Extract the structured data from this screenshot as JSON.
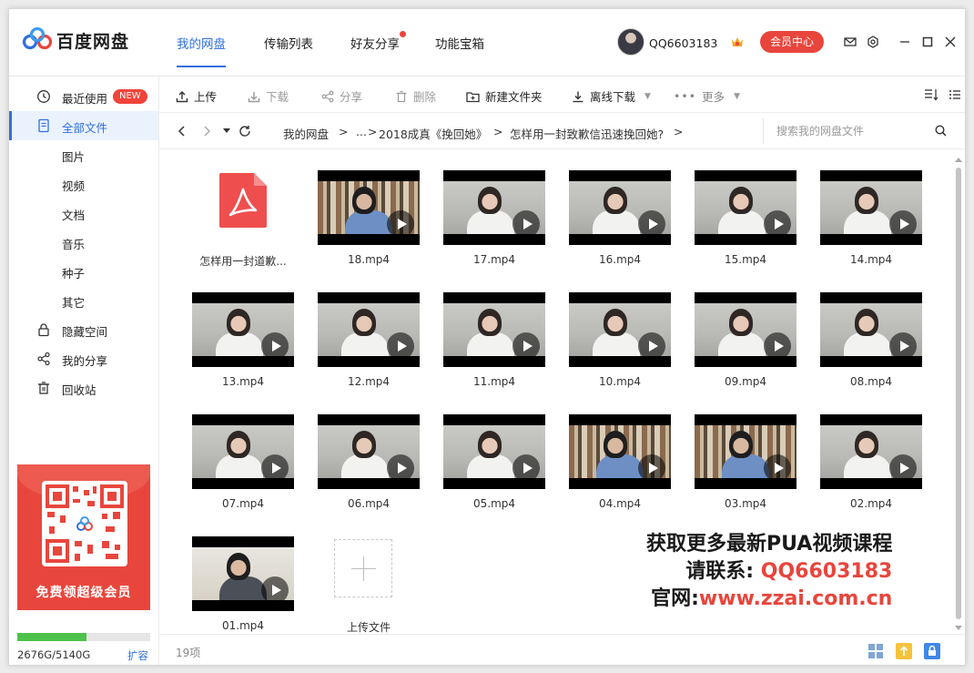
{
  "app": {
    "name": "百度网盘"
  },
  "nav_tabs": [
    {
      "label": "我的网盘",
      "active": true
    },
    {
      "label": "传输列表"
    },
    {
      "label": "好友分享",
      "dot": true
    },
    {
      "label": "功能宝箱"
    }
  ],
  "user": {
    "name": "QQ6603183",
    "vip_label": "会员中心"
  },
  "colors": {
    "accent": "#2f6fde",
    "red": "#e8453c",
    "quota": "#4dc24a"
  },
  "sidebar": {
    "items": [
      {
        "label": "最近使用",
        "icon": "clock-icon",
        "badge": "NEW"
      },
      {
        "label": "全部文件",
        "icon": "file-icon",
        "active": true
      },
      {
        "label": "图片"
      },
      {
        "label": "视频"
      },
      {
        "label": "文档"
      },
      {
        "label": "音乐"
      },
      {
        "label": "种子"
      },
      {
        "label": "其它"
      },
      {
        "label": "隐藏空间",
        "icon": "lock-icon"
      },
      {
        "label": "我的分享",
        "icon": "share-icon"
      },
      {
        "label": "回收站",
        "icon": "trash-icon"
      }
    ],
    "promo_text": "免费领超级会员",
    "quota_text": "2676G/5140G",
    "quota_fraction": 0.52,
    "expand_label": "扩容"
  },
  "toolbar": {
    "upload": "上传",
    "download": "下载",
    "share": "分享",
    "delete": "删除",
    "new_folder": "新建文件夹",
    "offline": "离线下载",
    "more": "更多"
  },
  "breadcrumb": {
    "items": [
      "我的网盘",
      "...",
      "2018成真《挽回她》",
      "怎样用一封致歉信迅速挽回她?"
    ],
    "separator": ">"
  },
  "search": {
    "placeholder": "搜索我的网盘文件"
  },
  "files": [
    {
      "name": "怎样用一封道歉...",
      "kind": "pdf"
    },
    {
      "name": "18.mp4",
      "kind": "video",
      "style": "office"
    },
    {
      "name": "17.mp4",
      "kind": "video",
      "style": "woman"
    },
    {
      "name": "16.mp4",
      "kind": "video",
      "style": "woman"
    },
    {
      "name": "15.mp4",
      "kind": "video",
      "style": "woman"
    },
    {
      "name": "14.mp4",
      "kind": "video",
      "style": "woman"
    },
    {
      "name": "13.mp4",
      "kind": "video",
      "style": "woman"
    },
    {
      "name": "12.mp4",
      "kind": "video",
      "style": "woman"
    },
    {
      "name": "11.mp4",
      "kind": "video",
      "style": "woman"
    },
    {
      "name": "10.mp4",
      "kind": "video",
      "style": "woman"
    },
    {
      "name": "09.mp4",
      "kind": "video",
      "style": "woman"
    },
    {
      "name": "08.mp4",
      "kind": "video",
      "style": "woman"
    },
    {
      "name": "07.mp4",
      "kind": "video",
      "style": "woman"
    },
    {
      "name": "06.mp4",
      "kind": "video",
      "style": "woman"
    },
    {
      "name": "05.mp4",
      "kind": "video",
      "style": "woman"
    },
    {
      "name": "04.mp4",
      "kind": "video",
      "style": "office"
    },
    {
      "name": "03.mp4",
      "kind": "video",
      "style": "office"
    },
    {
      "name": "02.mp4",
      "kind": "video",
      "style": "woman"
    },
    {
      "name": "01.mp4",
      "kind": "video",
      "style": "man"
    },
    {
      "name": "上传文件",
      "kind": "upload"
    }
  ],
  "watermark": {
    "line1": "获取更多最新PUA视频课程",
    "line2_label": "请联系:",
    "line2_value": "QQ6603183",
    "line3_label": "官网:",
    "line3_value": "www.zzai.com.cn"
  },
  "status": {
    "count": "19项"
  }
}
